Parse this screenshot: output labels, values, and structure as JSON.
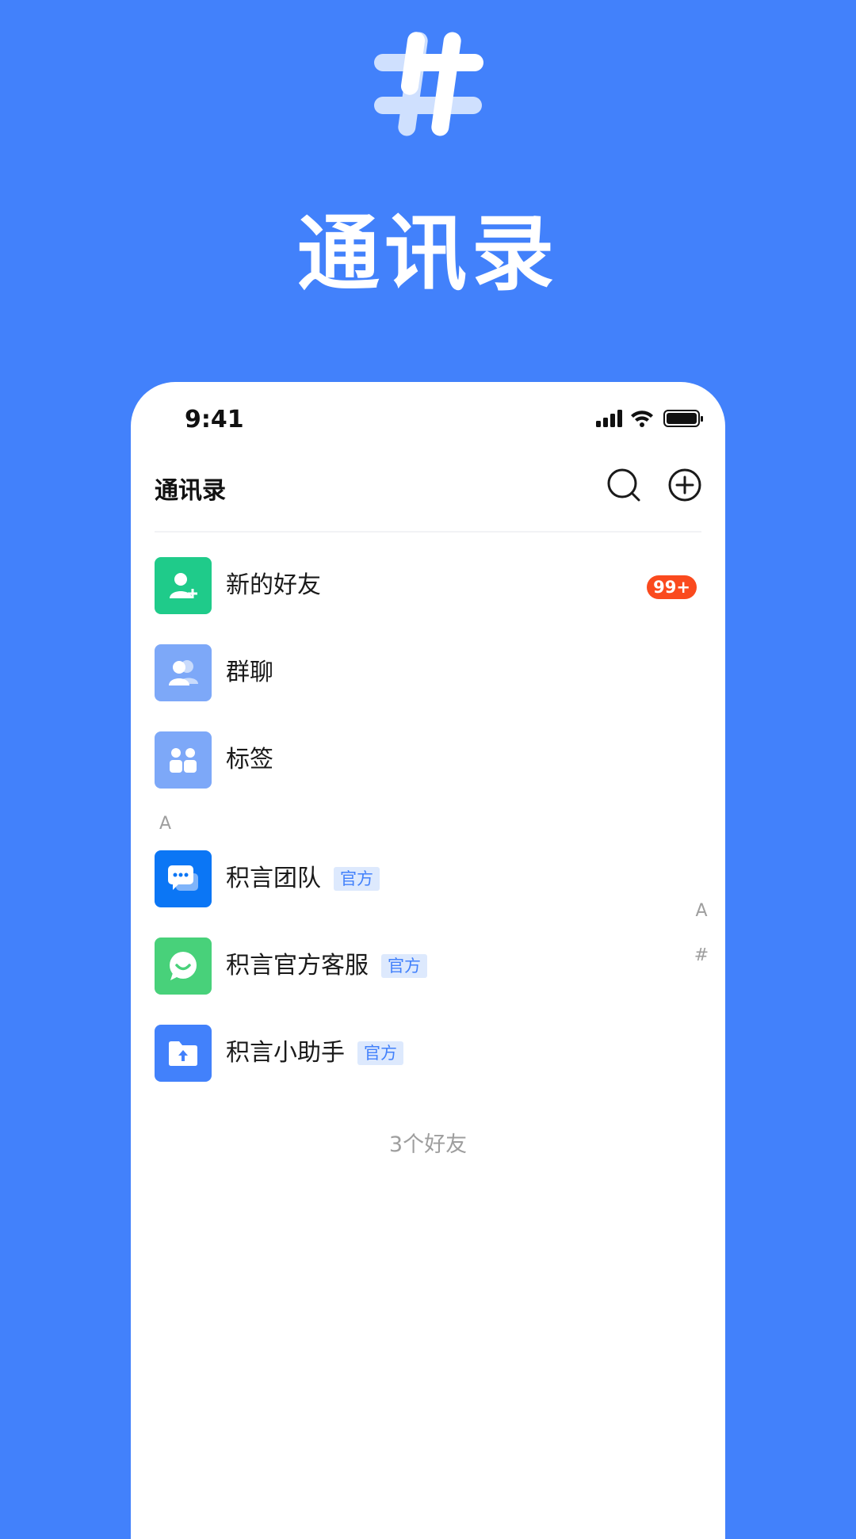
{
  "hero": {
    "title": "通讯录"
  },
  "status_bar": {
    "time": "9:41"
  },
  "nav": {
    "title": "通讯录",
    "search_icon": "search-icon",
    "add_icon": "plus-circle-icon"
  },
  "function_items": [
    {
      "label": "新的好友",
      "icon": "add-user-icon",
      "color": "#1FCB8A",
      "badge": "99+"
    },
    {
      "label": "群聊",
      "icon": "group-icon",
      "color": "#7DA8F8"
    },
    {
      "label": "标签",
      "icon": "tag-people-icon",
      "color": "#7DA8F8"
    }
  ],
  "section": {
    "letter": "A"
  },
  "contacts": [
    {
      "name": "积言团队",
      "tag": "官方",
      "icon": "chat-bubble-icon",
      "color": "#0B76F5"
    },
    {
      "name": "积言官方客服",
      "tag": "官方",
      "icon": "smile-chat-icon",
      "color": "#48D17A"
    },
    {
      "name": "积言小助手",
      "tag": "官方",
      "icon": "upload-folder-icon",
      "color": "#4281FB"
    }
  ],
  "index_bar": [
    "A",
    "#"
  ],
  "footer": {
    "count_text": "3个好友"
  },
  "colors": {
    "background": "#4281FB",
    "badge": "#FA4A1E",
    "official_tag_bg": "#DDE9FD"
  }
}
